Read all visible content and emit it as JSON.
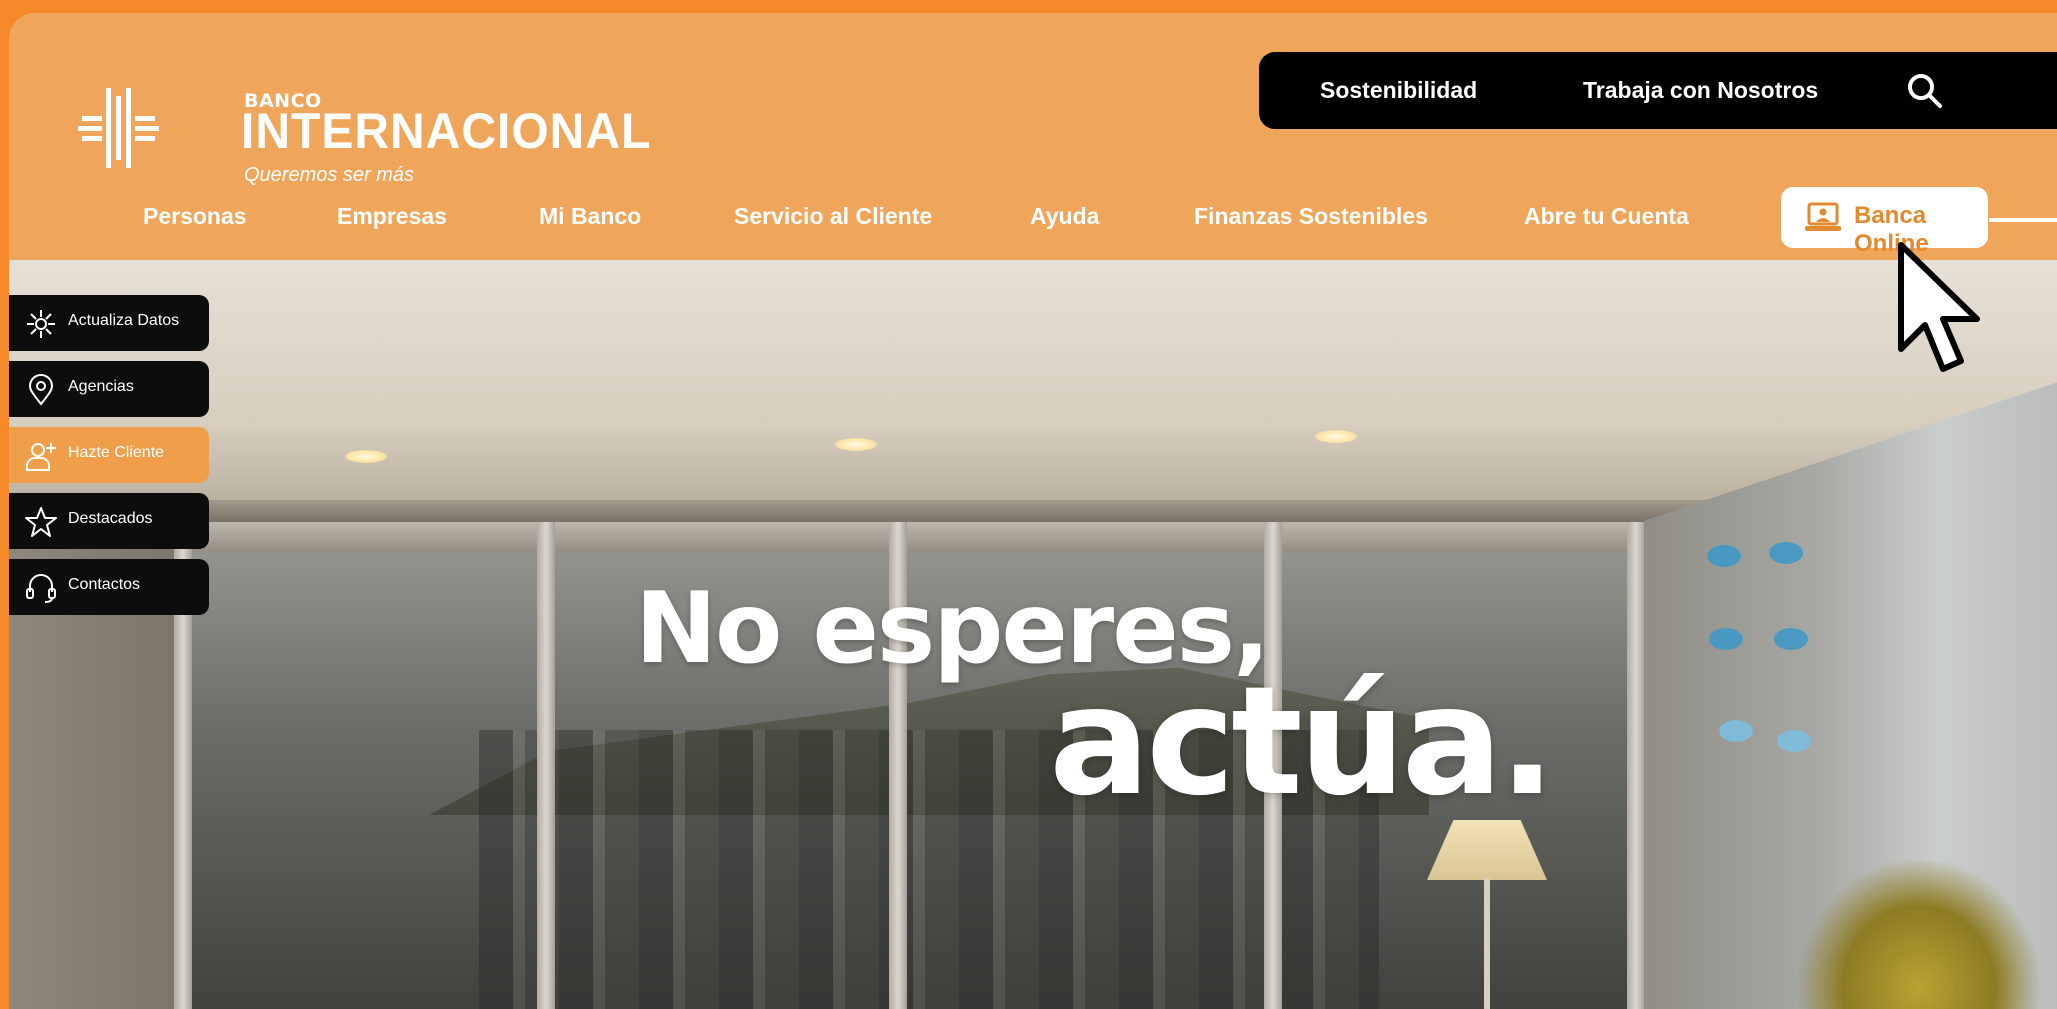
{
  "brand": {
    "banco": "BANCO",
    "name": "INTERNACIONAL",
    "tagline": "Queremos ser más"
  },
  "topbar": {
    "links": [
      "Sostenibilidad",
      "Trabaja con Nosotros"
    ],
    "search_icon": "search-icon"
  },
  "nav": {
    "items": [
      "Personas",
      "Empresas",
      "Mi Banco",
      "Servicio al Cliente",
      "Ayuda",
      "Finanzas Sostenibles",
      "Abre tu Cuenta"
    ]
  },
  "banca_online": {
    "label": "Banca Online",
    "icon": "laptop-user-icon"
  },
  "quick_menu": [
    {
      "label": "Actualiza Datos",
      "icon": "update-data-icon",
      "active": false
    },
    {
      "label": "Agencias",
      "icon": "location-pin-icon",
      "active": false
    },
    {
      "label": "Hazte Cliente",
      "icon": "add-user-icon",
      "active": true
    },
    {
      "label": "Destacados",
      "icon": "star-icon",
      "active": false
    },
    {
      "label": "Contactos",
      "icon": "headset-icon",
      "active": false
    }
  ],
  "hero": {
    "line1": "No esperes,",
    "line2": "actúa."
  },
  "colors": {
    "page_border": "#f6882a",
    "header": "#efa65b",
    "accent": "#e3892f",
    "dark": "#000000"
  }
}
